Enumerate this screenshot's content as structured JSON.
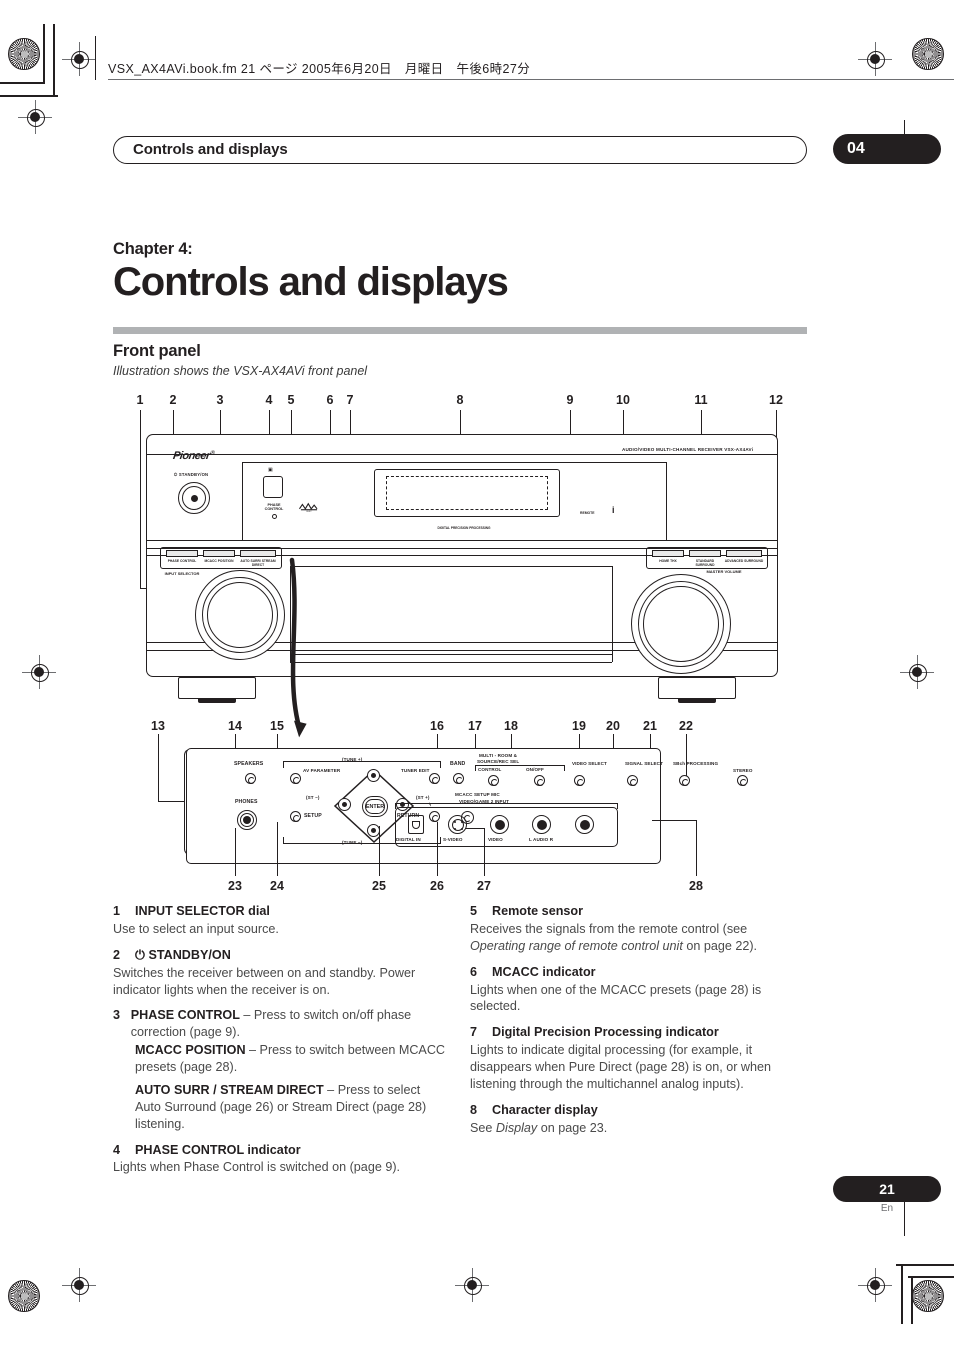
{
  "slug": "VSX_AX4AVi.book.fm 21 ページ 2005年6月20日　月曜日　午後6時27分",
  "header": {
    "running_title": "Controls and displays",
    "chapter_badge": "04"
  },
  "title": {
    "chapter_label": "Chapter 4:",
    "chapter_title": "Controls and displays",
    "section": "Front panel",
    "section_sub": "Illustration shows the VSX-AX4AVi front panel"
  },
  "figure": {
    "callouts_top": [
      "1",
      "2",
      "3",
      "4",
      "5",
      "6",
      "7",
      "8",
      "9",
      "10",
      "11",
      "12"
    ],
    "callouts_mid": [
      "13",
      "14",
      "15",
      "16",
      "17",
      "18",
      "19",
      "20",
      "21",
      "22"
    ],
    "callouts_bottom": [
      "23",
      "24",
      "25",
      "26",
      "27",
      "28"
    ],
    "brand": "Pioneer",
    "brand_mark": "®",
    "standby_label": "STANDBY/ON",
    "standby_symbol": "⏻",
    "phase_control_label": "PHASE CONTROL",
    "display_note": "DIGITAL PRECISION PROCESSING",
    "model_line": "AUDIO/VIDEO MULTI-CHANNEL RECEIVER   VSX-AX4AVi",
    "remote_sensor_label": "REMOTE",
    "mcacc_indicator": "i",
    "input_selector_label": "INPUT SELECTOR",
    "master_volume_label": "MASTER VOLUME",
    "left_keys": [
      "PHASE CONTROL",
      "MCACC POSITION",
      "AUTO SURR/ STREAM DIRECT"
    ],
    "right_keys": [
      "HOME THX",
      "STANDARD SURROUND",
      "ADVANCED SURROUND"
    ],
    "detail": {
      "speakers": "SPEAKERS",
      "phones": "PHONES",
      "av_parameter": "AV PARAMETER",
      "setup": "SETUP",
      "tune_up": "(TUNE +)",
      "tune_dn": "(TUNE −)",
      "st_minus": "(ST −)",
      "st_plus": "(ST +)",
      "enter": "ENTER",
      "tuner_edit": "TUNER EDIT",
      "return": "RETURN",
      "band": "BAND",
      "multiroom_l1": "MULTI - ROOM &",
      "multiroom_l2": "SOURCE/REC SEL",
      "multiroom_control": "CONTROL",
      "multiroom_onoff": "ON/OFF",
      "video_select": "VIDEO SELECT",
      "signal_select": "SIGNAL SELECT",
      "sbch_processing": "SBch PROCESSING",
      "stereo": "STEREO",
      "mcacc_setup_mic": "MCACC SETUP MIC",
      "video_game2": "VIDEO/GAME 2 INPUT",
      "jacks": [
        "DIGITAL IN",
        "S-VIDEO",
        "VIDEO",
        "L  AUDIO  R"
      ]
    }
  },
  "left_column": [
    {
      "num": "1",
      "title": "INPUT SELECTOR dial",
      "body": "Use to select an input source."
    },
    {
      "num": "2",
      "title": "⏻ STANDBY/ON",
      "body": "Switches the receiver between on and standby. Power indicator lights when the receiver is on."
    },
    {
      "num": "3",
      "title": "PHASE CONTROL",
      "body_1_bold": "PHASE CONTROL",
      "body_1_rest": " – Press to switch on/off phase correction (page 9).",
      "body_2_bold": "MCACC POSITION",
      "body_2_rest": " – Press to switch between MCACC presets (page 28).",
      "body_3_bold": "AUTO SURR / STREAM DIRECT",
      "body_3_rest": " – Press to select Auto Surround (page 26) or Stream Direct (page 28) listening."
    },
    {
      "num": "4",
      "title": "PHASE CONTROL indicator",
      "body": "Lights when Phase Control is switched on (page 9)."
    }
  ],
  "right_column": [
    {
      "num": "5",
      "title": "Remote sensor",
      "body_pre": "Receives the signals from the remote control (see ",
      "body_italic": "Operating range of remote control unit",
      "body_post": " on page 22)."
    },
    {
      "num": "6",
      "title": "MCACC indicator",
      "body": "Lights when one of the MCACC presets (page 28) is selected."
    },
    {
      "num": "7",
      "title": "Digital Precision Processing indicator",
      "body": "Lights to indicate digital processing (for example, it disappears when Pure Direct (page 28) is on, or when listening through the multichannel analog inputs)."
    },
    {
      "num": "8",
      "title": "Character display",
      "body_pre": "See ",
      "body_italic": "Display",
      "body_post": " on page 23."
    }
  ],
  "footer": {
    "page_number": "21",
    "language": "En"
  }
}
